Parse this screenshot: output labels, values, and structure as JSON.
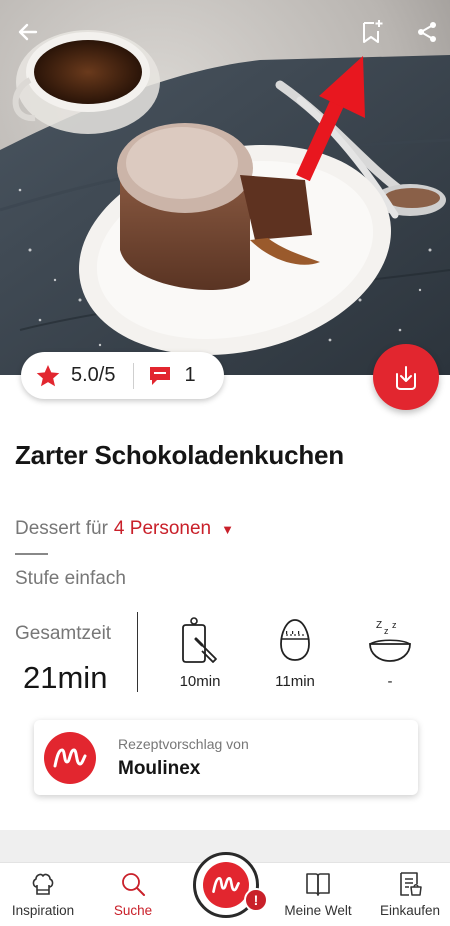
{
  "recipe": {
    "title": "Zarter Schokoladenkuchen",
    "rating": "5.0/5",
    "comment_count": "1",
    "category": "Dessert für",
    "servings": "4 Personen",
    "level": "Stufe einfach",
    "total_time_label": "Gesamtzeit",
    "total_time_value": "21min",
    "prep_time": "10min",
    "cook_time": "11min",
    "rest_time": "-"
  },
  "sponsor": {
    "subtitle": "Rezeptvorschlag von",
    "name": "Moulinex"
  },
  "bottom_nav": {
    "items": [
      {
        "label": "Inspiration",
        "icon": "chef-hat-icon"
      },
      {
        "label": "Suche",
        "icon": "search-icon"
      },
      {
        "label": "Meine Welt",
        "icon": "book-icon"
      },
      {
        "label": "Einkaufen",
        "icon": "shopping-list-icon"
      }
    ],
    "center_badge": "!"
  },
  "colors": {
    "accent": "#e2262f",
    "accent_text": "#c9202a",
    "muted_text": "#777777"
  }
}
